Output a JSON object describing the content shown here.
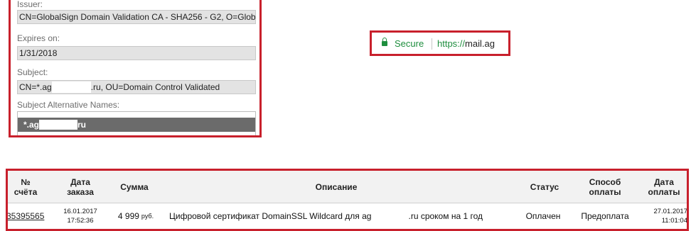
{
  "certificate": {
    "issuer_label": "Issuer:",
    "issuer_value": "CN=GlobalSign Domain Validation CA - SHA256 - G2, O=Globa",
    "expires_label": "Expires on:",
    "expires_value": "1/31/2018",
    "subject_label": "Subject:",
    "subject_value_prefix": "CN=*.ag",
    "subject_value_suffix": ".ru, OU=Domain Control Validated",
    "san_label": "Subject Alternative Names:",
    "san_prefix": "*.ag",
    "san_suffix": "ru"
  },
  "address_bar": {
    "secure_label": "Secure",
    "scheme": "https://",
    "host": "mail.ag",
    "icon": "lock-icon",
    "accent_color": "#1e8e3e"
  },
  "orders": {
    "headers": {
      "number": "№\nсчёта",
      "date": "Дата\nзаказа",
      "sum": "Сумма",
      "description": "Описание",
      "status": "Статус",
      "payment_method": "Способ\nоплаты",
      "payment_date": "Дата\nоплаты"
    },
    "rows": [
      {
        "number": "35395565",
        "date": "16.01.2017\n17:52:36",
        "sum": "4 999",
        "currency": "руб.",
        "description_prefix": "Цифровой сертификат DomainSSL Wildcard для ag",
        "description_suffix": ".ru сроком на 1 год",
        "status": "Оплачен",
        "payment_method": "Предоплата",
        "payment_date": "27.01.2017\n11:01:04"
      }
    ]
  },
  "highlight_color": "#c8202c"
}
